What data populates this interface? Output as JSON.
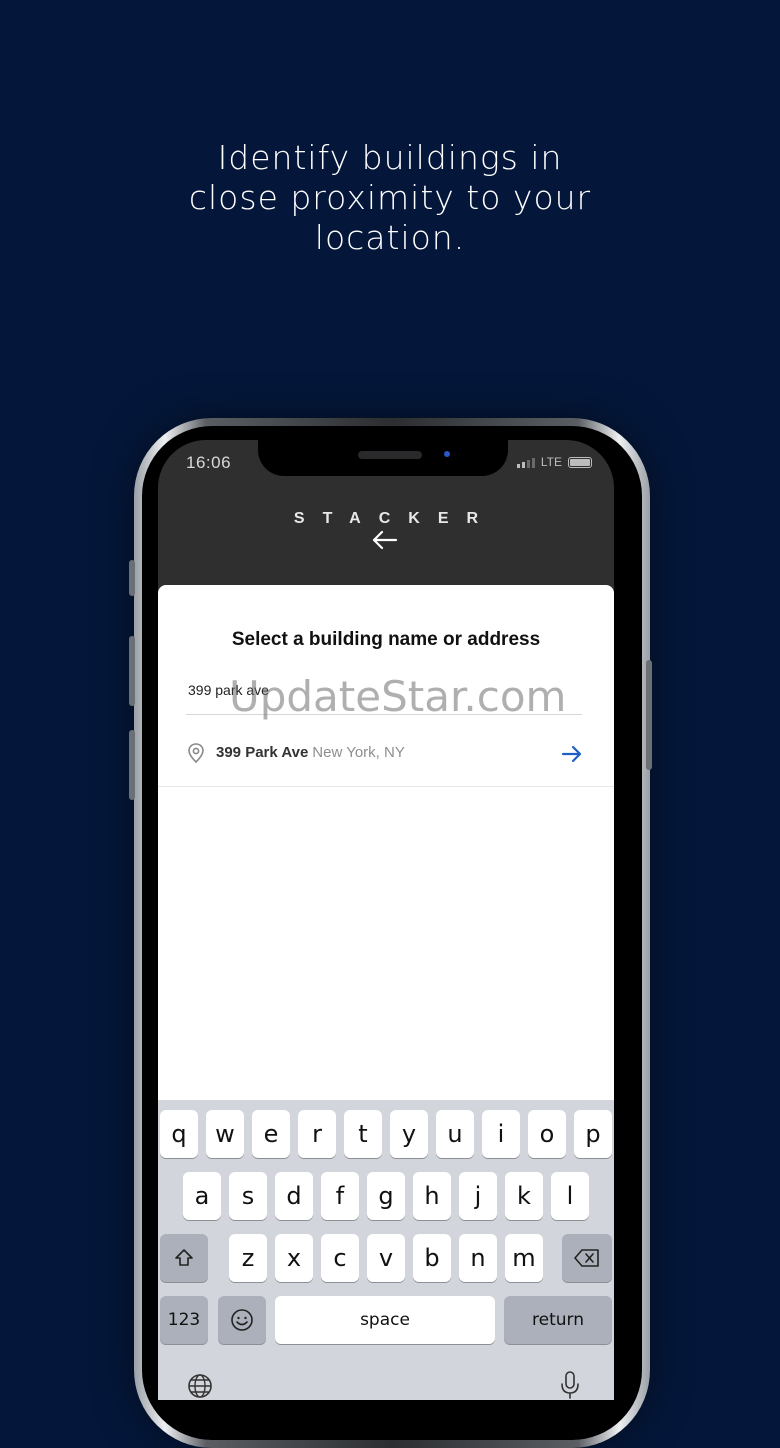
{
  "headline": [
    "Identify buildings in",
    "close proximity to your",
    "location."
  ],
  "status": {
    "time": "16:06",
    "network": "LTE"
  },
  "app": {
    "brand": "STACKER"
  },
  "card": {
    "title": "Select a building name or address",
    "search_value": "399 park ave"
  },
  "suggestion": {
    "name": "399 Park Ave",
    "city": "New York, NY"
  },
  "watermark": "UpdateStar.com",
  "keyboard": {
    "row1": [
      "q",
      "w",
      "e",
      "r",
      "t",
      "y",
      "u",
      "i",
      "o",
      "p"
    ],
    "row2": [
      "a",
      "s",
      "d",
      "f",
      "g",
      "h",
      "j",
      "k",
      "l"
    ],
    "row3": [
      "z",
      "x",
      "c",
      "v",
      "b",
      "n",
      "m"
    ],
    "numbers_label": "123",
    "space_label": "space",
    "return_label": "return"
  },
  "colors": {
    "background": "#04173a",
    "accent": "#1f5fc4"
  }
}
